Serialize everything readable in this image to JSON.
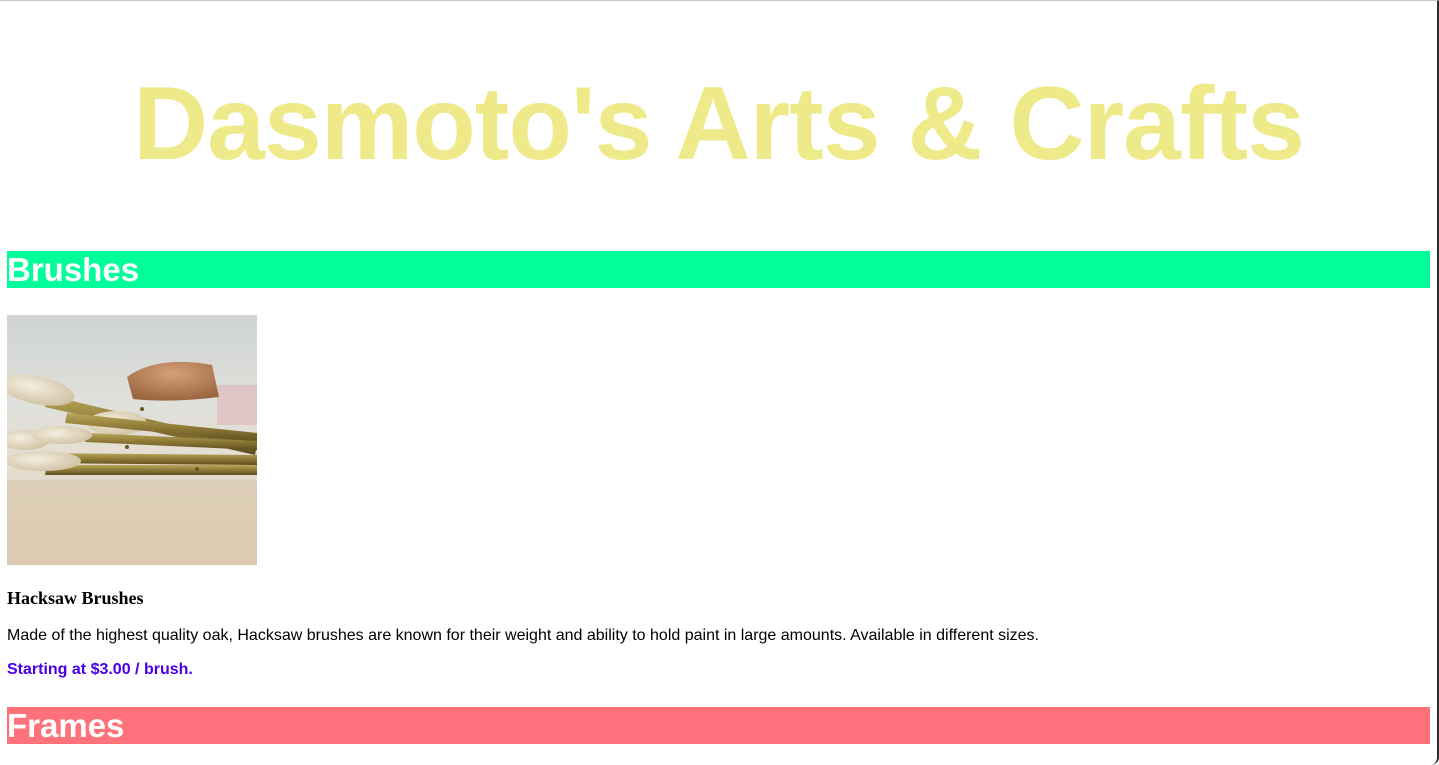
{
  "header": {
    "title": "Dasmoto's Arts & Crafts"
  },
  "sections": [
    {
      "heading": "Brushes",
      "heading_color": "#00ff9b",
      "product": {
        "image_subject": "paintbrushes-photo",
        "name": "Hacksaw Brushes",
        "description": "Made of the highest quality oak, Hacksaw brushes are known for their weight and ability to hold paint in large amounts. Available in different sizes.",
        "price": "Starting at $3.00 / brush."
      }
    },
    {
      "heading": "Frames",
      "heading_color": "#ff717b"
    }
  ],
  "colors": {
    "title": "#eeea8a",
    "heading_text": "#ffffff",
    "price": "#4a00e6"
  }
}
